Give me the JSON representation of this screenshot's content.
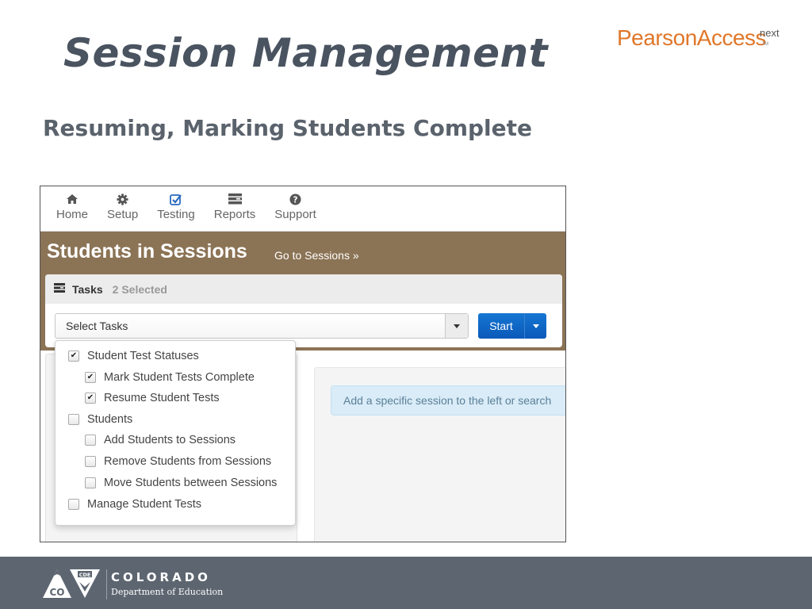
{
  "slide": {
    "title": "Session Management",
    "subtitle": "Resuming, Marking Students Complete",
    "brand": {
      "name": "PearsonAccess",
      "suffix": "next",
      "tm": "TM",
      "color": "#e0772a"
    }
  },
  "app": {
    "nav": [
      {
        "label": "Home",
        "icon": "home-icon"
      },
      {
        "label": "Setup",
        "icon": "gear-icon"
      },
      {
        "label": "Testing",
        "icon": "checkbox-icon"
      },
      {
        "label": "Reports",
        "icon": "reports-icon"
      },
      {
        "label": "Support",
        "icon": "question-icon"
      }
    ],
    "page_heading": "Students in Sessions",
    "goto_link": "Go to Sessions »",
    "band_color": "#8b7355",
    "tasks": {
      "title": "Tasks",
      "selected_count": "2 Selected",
      "select_value": "Select Tasks",
      "start_label": "Start"
    },
    "task_options": [
      {
        "label": "Student Test Statuses",
        "checked": true,
        "level": 0
      },
      {
        "label": "Mark Student Tests Complete",
        "checked": true,
        "level": 1
      },
      {
        "label": "Resume Student Tests",
        "checked": true,
        "level": 1
      },
      {
        "label": "Students",
        "checked": false,
        "level": 0
      },
      {
        "label": "Add Students to Sessions",
        "checked": false,
        "level": 1
      },
      {
        "label": "Remove Students from Sessions",
        "checked": false,
        "level": 1
      },
      {
        "label": "Move Students between Sessions",
        "checked": false,
        "level": 1
      },
      {
        "label": "Manage Student Tests",
        "checked": false,
        "level": 0
      }
    ],
    "info_message": "Add a specific session to the left or search"
  },
  "footer": {
    "org": "COLORADO",
    "dept": "Department of Education",
    "logo_text": "CO",
    "logo_badge": "CDE"
  }
}
